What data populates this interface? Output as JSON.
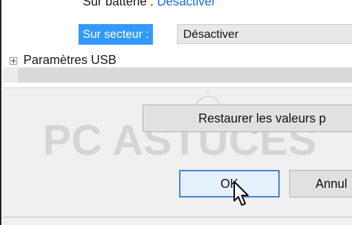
{
  "tree": {
    "battery": {
      "label": "Sur batterie :",
      "value": "Désactiver"
    },
    "ac": {
      "label": "Sur secteur :",
      "value": "Désactiver"
    },
    "usb": {
      "label": "Paramètres USB"
    }
  },
  "buttons": {
    "restore": "Restaurer les valeurs p",
    "ok": "OK",
    "cancel": "Annul"
  },
  "watermark": {
    "text": "PC ASTUCES"
  },
  "colors": {
    "selection": "#3399ff",
    "link": "#1a6fd6",
    "focus_border": "#3c7fd8"
  },
  "icons": {
    "expander": "plus-expander-icon",
    "cursor": "mouse-pointer-icon"
  }
}
